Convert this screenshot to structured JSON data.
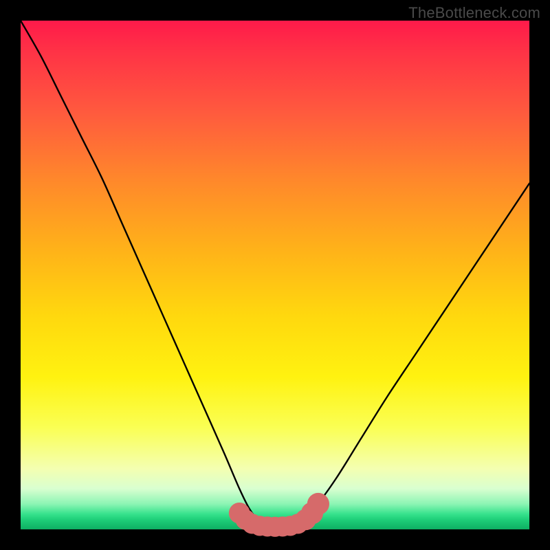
{
  "watermark": "TheBottleneck.com",
  "colors": {
    "frame": "#000000",
    "curve": "#000000",
    "marker_fill": "#d66a6a",
    "marker_stroke": "#c85a5a"
  },
  "chart_data": {
    "type": "line",
    "title": "",
    "xlabel": "",
    "ylabel": "",
    "xlim": [
      0,
      100
    ],
    "ylim": [
      0,
      100
    ],
    "series": [
      {
        "name": "bottleneck-curve",
        "x": [
          0,
          4,
          8,
          12,
          16,
          20,
          24,
          28,
          32,
          36,
          40,
          43,
          45,
          47,
          49,
          51,
          53,
          55,
          58,
          62,
          67,
          72,
          78,
          84,
          90,
          96,
          100
        ],
        "y": [
          100,
          93,
          85,
          77,
          69,
          60,
          51,
          42,
          33,
          24,
          15,
          8,
          4,
          1.5,
          0.6,
          0.5,
          0.7,
          1.6,
          4.5,
          10,
          18,
          26,
          35,
          44,
          53,
          62,
          68
        ]
      }
    ],
    "markers": {
      "name": "bottom-cluster",
      "points": [
        {
          "x": 43.0,
          "y": 3.2,
          "r": 1.4
        },
        {
          "x": 44.2,
          "y": 1.9,
          "r": 1.3
        },
        {
          "x": 45.5,
          "y": 1.1,
          "r": 1.3
        },
        {
          "x": 47.0,
          "y": 0.7,
          "r": 1.3
        },
        {
          "x": 48.5,
          "y": 0.55,
          "r": 1.3
        },
        {
          "x": 50.0,
          "y": 0.5,
          "r": 1.3
        },
        {
          "x": 51.5,
          "y": 0.55,
          "r": 1.3
        },
        {
          "x": 53.0,
          "y": 0.7,
          "r": 1.3
        },
        {
          "x": 54.5,
          "y": 1.1,
          "r": 1.3
        },
        {
          "x": 56.0,
          "y": 1.9,
          "r": 1.4
        },
        {
          "x": 57.3,
          "y": 3.2,
          "r": 1.5
        },
        {
          "x": 58.5,
          "y": 5.0,
          "r": 1.5
        }
      ]
    }
  }
}
